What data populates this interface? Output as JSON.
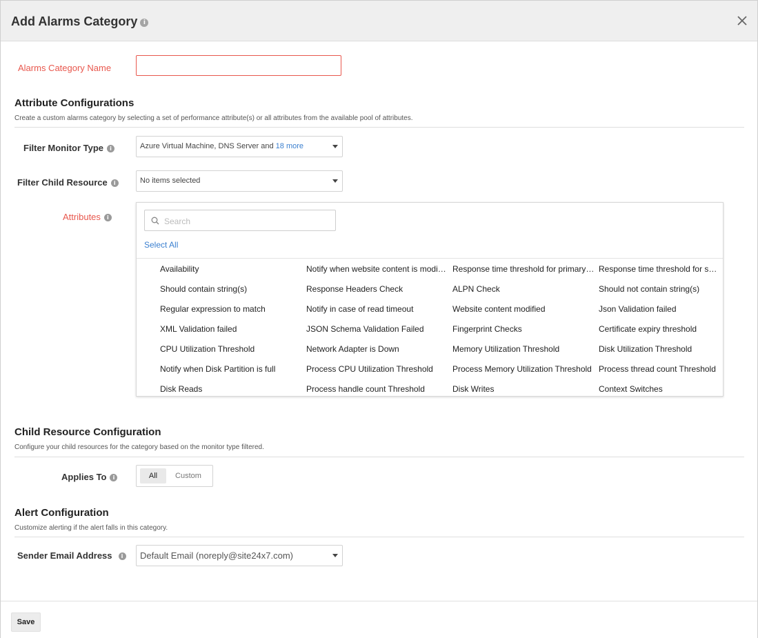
{
  "header": {
    "title": "Add Alarms Category"
  },
  "name_field": {
    "label": "Alarms Category Name",
    "value": "",
    "placeholder": ""
  },
  "attribute_config": {
    "title": "Attribute Configurations",
    "description": "Create a custom alarms category by selecting a set of performance attribute(s) or all attributes from the available pool of attributes.",
    "filter_monitor_type": {
      "label": "Filter Monitor Type",
      "value": "Azure Virtual Machine, DNS Server and",
      "more": "18 more"
    },
    "filter_child_resource": {
      "label": "Filter Child Resource",
      "value": "No items selected"
    },
    "attributes": {
      "label": "Attributes",
      "search_placeholder": "Search",
      "select_all": "Select All",
      "items": [
        "Availability",
        "Notify when website content is modified",
        "Response time threshold for primary location",
        "Response time threshold for secondary location",
        "Should contain string(s)",
        "Response Headers Check",
        "ALPN Check",
        "Should not contain string(s)",
        "Regular expression to match",
        "Notify in case of read timeout",
        "Website content modified",
        "Json Validation failed",
        "XML Validation failed",
        "JSON Schema Validation Failed",
        "Fingerprint Checks",
        "Certificate expiry threshold",
        "CPU Utilization Threshold",
        "Network Adapter is Down",
        "Memory Utilization Threshold",
        "Disk Utilization Threshold",
        "Notify when Disk Partition is full",
        "Process CPU Utilization Threshold",
        "Process Memory Utilization Threshold",
        "Process thread count Threshold",
        "Disk Reads",
        "Process handle count Threshold",
        "Disk Writes",
        "Context Switches"
      ]
    }
  },
  "child_resource_config": {
    "title": "Child Resource Configuration",
    "description": "Configure your child resources for the category based on the monitor type filtered.",
    "applies_to": {
      "label": "Applies To",
      "options": [
        "All",
        "Custom"
      ],
      "selected": "All"
    }
  },
  "alert_config": {
    "title": "Alert Configuration",
    "description": "Customize alerting if the alert falls in this category.",
    "sender_email": {
      "label": "Sender Email Address",
      "value": "Default Email (noreply@site24x7.com)"
    }
  },
  "footer": {
    "save_label": "Save"
  },
  "colors": {
    "required": "#e8574d",
    "link": "#3a7fcf",
    "header_bg": "#efefef"
  },
  "icons": {
    "close": "close-icon",
    "info": "info-icon",
    "search": "search-icon",
    "caret": "chevron-down-icon"
  }
}
